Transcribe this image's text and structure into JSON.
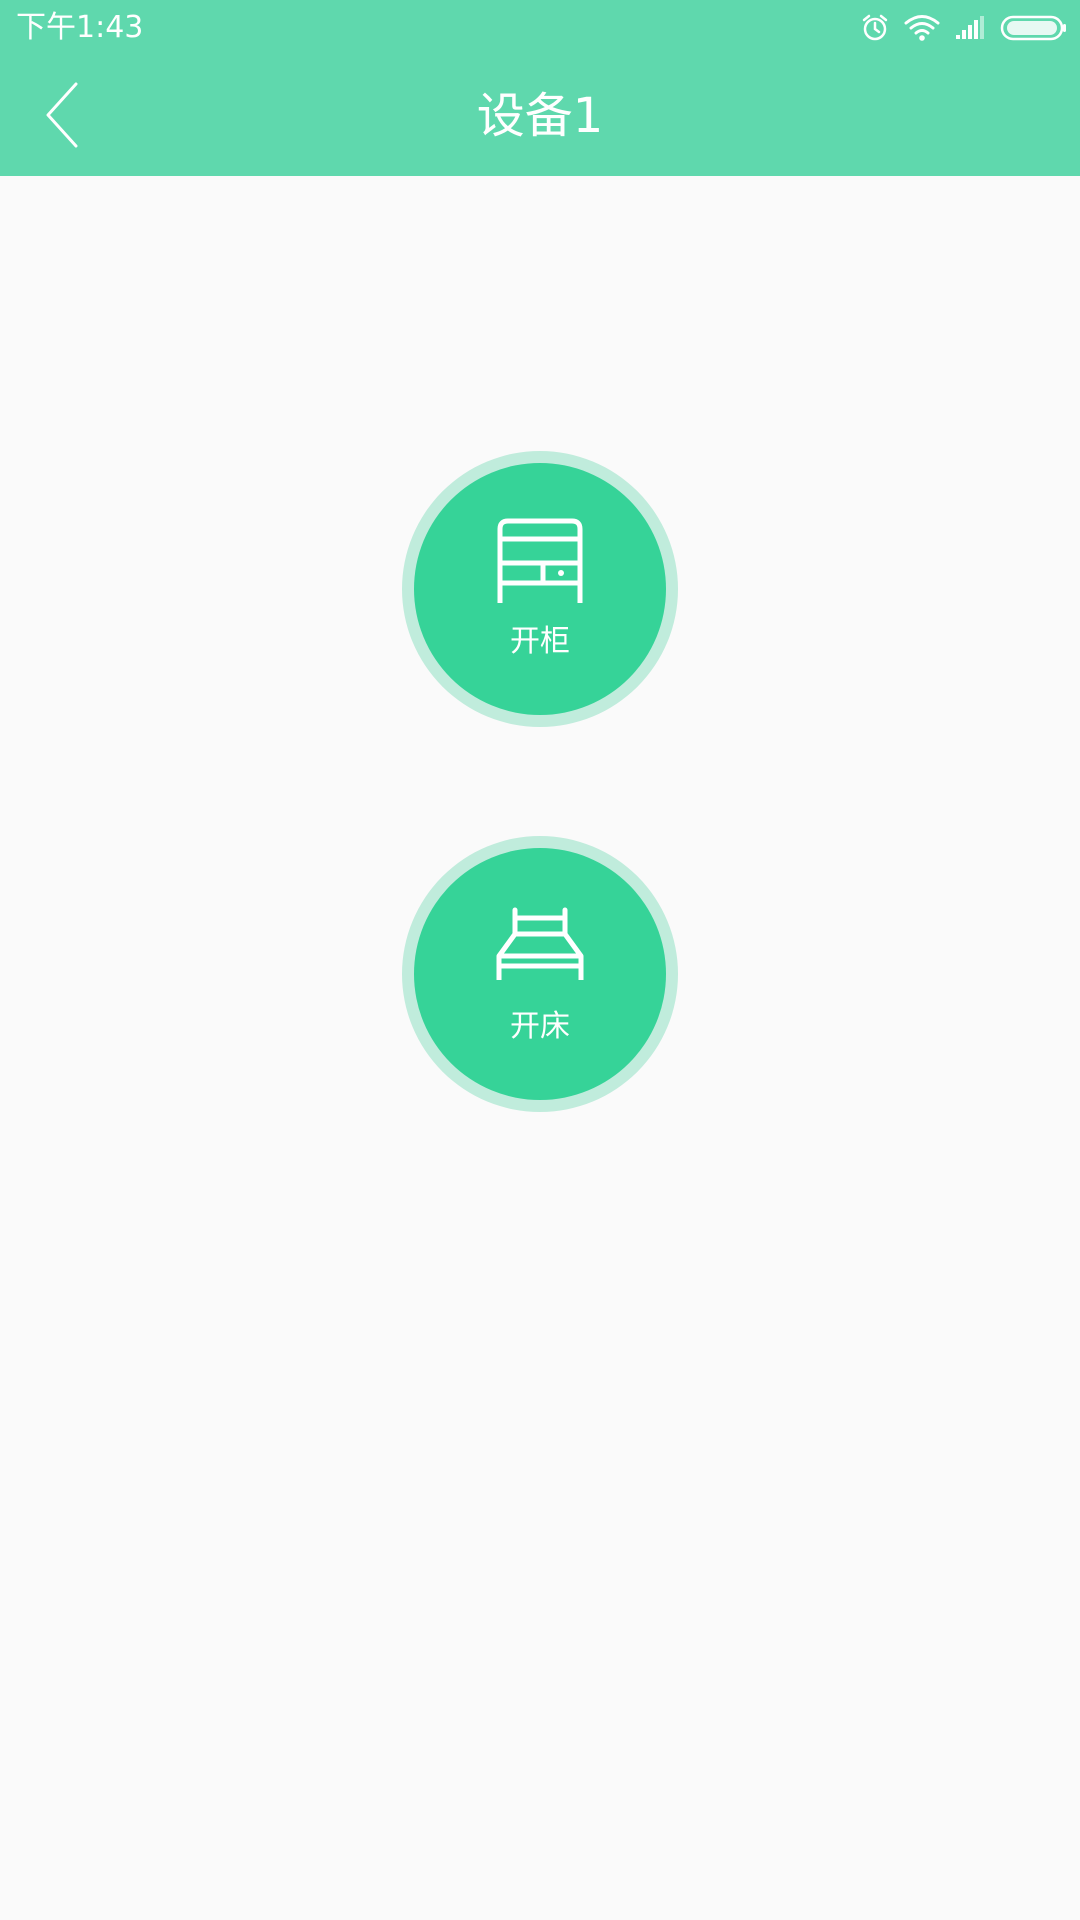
{
  "status_bar": {
    "time": "下午1:43",
    "icons": [
      "alarm-icon",
      "wifi-icon",
      "signal-icon",
      "battery-icon"
    ]
  },
  "header": {
    "title": "设备1",
    "back_icon": "chevron-left-icon"
  },
  "actions": [
    {
      "label": "开柜",
      "icon": "cabinet-icon"
    },
    {
      "label": "开床",
      "icon": "bed-icon"
    }
  ],
  "colors": {
    "header": "#5fd8ad",
    "button": "#36d398",
    "button_ring": "#c0ecdc",
    "background": "#fafafa"
  }
}
